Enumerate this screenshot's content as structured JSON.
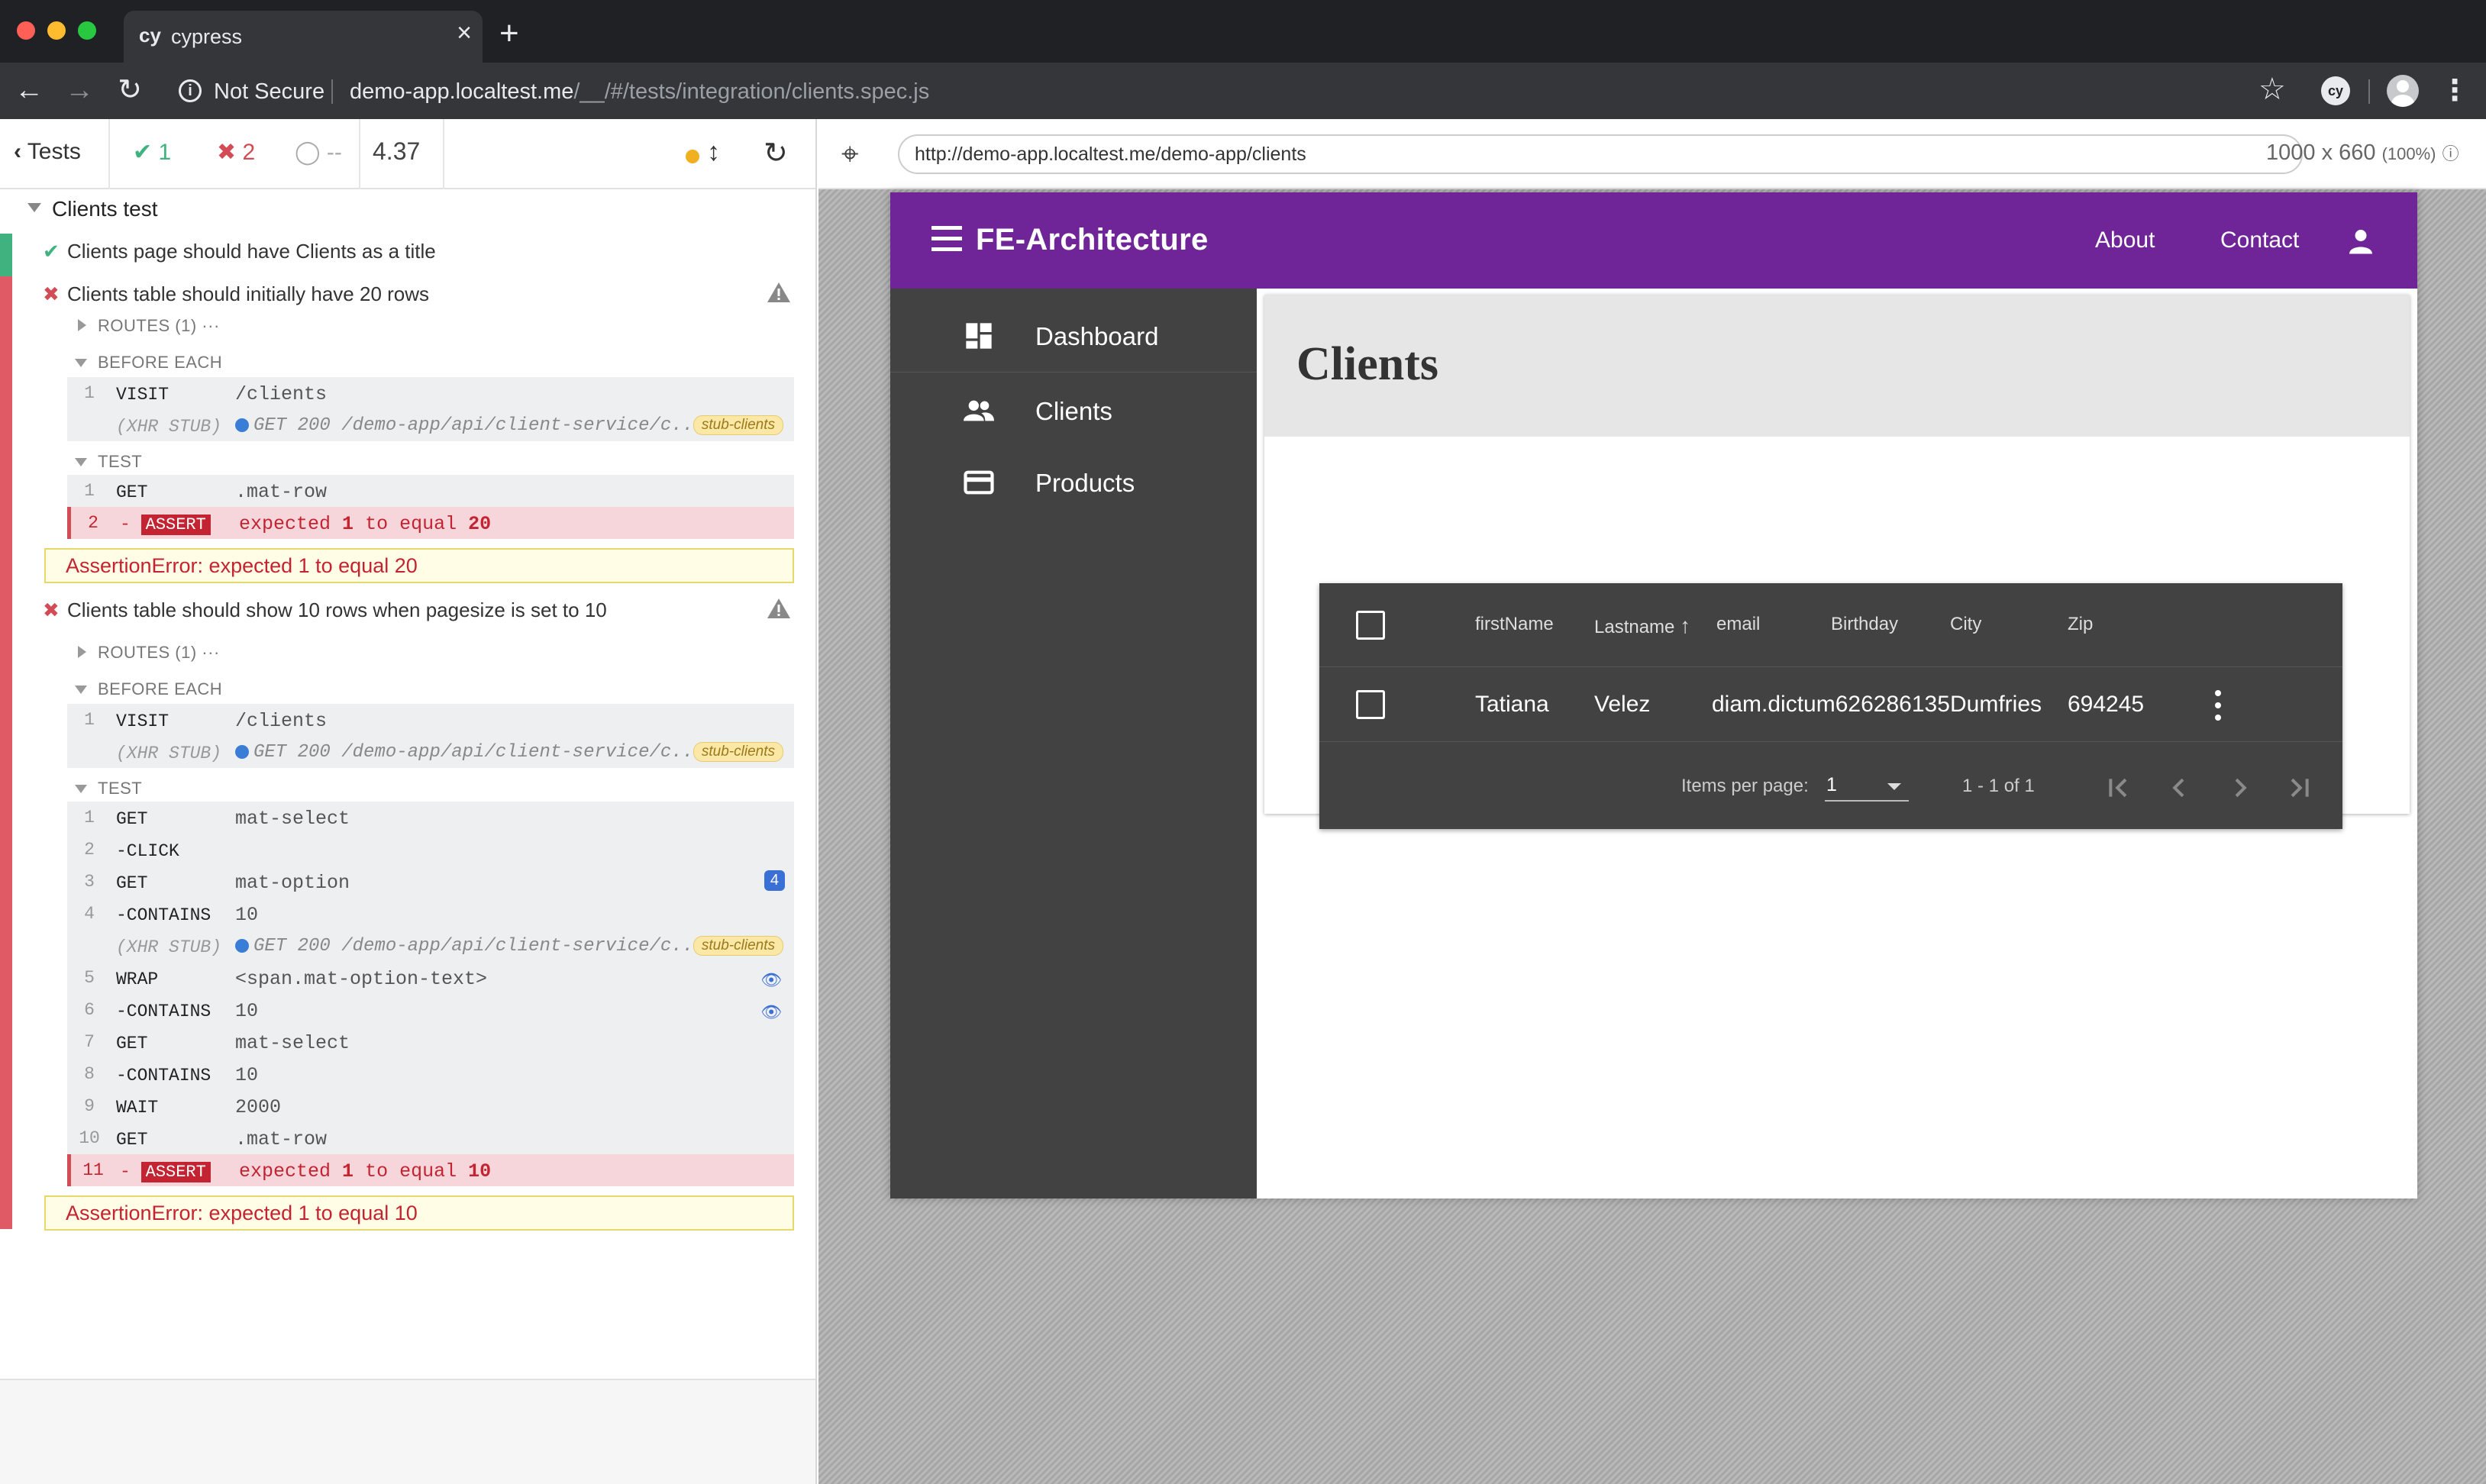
{
  "browser": {
    "tab_favicon": "cy",
    "tab_title": "cypress",
    "security_label": "Not Secure",
    "url_host": "demo-app.localtest.me",
    "url_path": "/__/#/tests/integration/clients.spec.js",
    "extension_label": "cy",
    "colors": {
      "tabbar": "#202124",
      "toolbar": "#35363a"
    }
  },
  "reporter": {
    "tests_label": "Tests",
    "passed": "1",
    "failed": "2",
    "pending": "--",
    "duration": "4.37",
    "suite_title": "Clients test",
    "tests": [
      {
        "title": "Clients page should have Clients as a title",
        "state": "passed"
      },
      {
        "title": "Clients table should initially have 20 rows",
        "state": "failed",
        "routes_label": "ROUTES (1)",
        "before_each_label": "BEFORE EACH",
        "test_label": "TEST",
        "before_each": [
          {
            "num": "1",
            "name": "VISIT",
            "message": "/clients"
          },
          {
            "num": "",
            "name": "(XHR STUB)",
            "message": "GET 200 /demo-app/api/client-service/c...",
            "alias": "stub-clients"
          }
        ],
        "commands": [
          {
            "num": "1",
            "name": "GET",
            "message": ".mat-row"
          },
          {
            "num": "2",
            "name": "- ASSERT",
            "badge": "ASSERT",
            "prefix": "-",
            "msg_pre": "expected",
            "msg_a": "1",
            "msg_mid": "to equal",
            "msg_b": "20"
          }
        ],
        "error": "AssertionError: expected 1 to equal 20"
      },
      {
        "title": "Clients table should show 10 rows when pagesize is set to 10",
        "state": "failed",
        "routes_label": "ROUTES (1)",
        "before_each_label": "BEFORE EACH",
        "test_label": "TEST",
        "before_each": [
          {
            "num": "1",
            "name": "VISIT",
            "message": "/clients"
          },
          {
            "num": "",
            "name": "(XHR STUB)",
            "message": "GET 200 /demo-app/api/client-service/c...",
            "alias": "stub-clients"
          }
        ],
        "commands": [
          {
            "num": "1",
            "name": "GET",
            "message": "mat-select"
          },
          {
            "num": "2",
            "name": "-CLICK",
            "message": ""
          },
          {
            "num": "3",
            "name": "GET",
            "message": "mat-option",
            "count": "4"
          },
          {
            "num": "4",
            "name": "-CONTAINS",
            "message": "10"
          },
          {
            "num": "",
            "name": "(XHR STUB)",
            "message": "GET 200 /demo-app/api/client-service/c...",
            "alias": "stub-clients"
          },
          {
            "num": "5",
            "name": "WRAP",
            "message": "<span.mat-option-text>"
          },
          {
            "num": "6",
            "name": "-CONTAINS",
            "message": "10"
          },
          {
            "num": "7",
            "name": "GET",
            "message": "mat-select"
          },
          {
            "num": "8",
            "name": "-CONTAINS",
            "message": "10"
          },
          {
            "num": "9",
            "name": "WAIT",
            "message": "2000"
          },
          {
            "num": "10",
            "name": "GET",
            "message": ".mat-row"
          },
          {
            "num": "11",
            "prefix": "-",
            "badge": "ASSERT",
            "msg_pre": "expected",
            "msg_a": "1",
            "msg_mid": "to equal",
            "msg_b": "10"
          }
        ],
        "error": "AssertionError: expected 1 to equal 10"
      }
    ],
    "colors": {
      "pass": "#3fb27f",
      "fail": "#d34b55",
      "pending_dot": "#f0b020"
    }
  },
  "aut": {
    "url": "http://demo-app.localtest.me/demo-app/clients",
    "viewport": "1000 x 660",
    "scale": "(100%)"
  },
  "app": {
    "title": "FE-Architecture",
    "nav_about": "About",
    "nav_contact": "Contact",
    "sidenav": [
      {
        "label": "Dashboard",
        "icon": "dashboard-icon"
      },
      {
        "label": "Clients",
        "icon": "people-icon"
      },
      {
        "label": "Products",
        "icon": "credit-card-icon"
      }
    ],
    "page_title": "Clients",
    "table": {
      "headers": [
        "firstName",
        "Lastname",
        "email",
        "Birthday",
        "City",
        "Zip"
      ],
      "sorted_column": "Lastname",
      "rows": [
        [
          "Tatiana",
          "Velez",
          "diam.dictum626286135",
          "",
          "Dumfries",
          "694245"
        ]
      ],
      "items_per_page_label": "Items per page:",
      "items_per_page": "1",
      "range": "1 - 1 of 1"
    },
    "colors": {
      "toolbar": "#6f2598",
      "sidenav": "#424242",
      "table": "#424242"
    }
  }
}
